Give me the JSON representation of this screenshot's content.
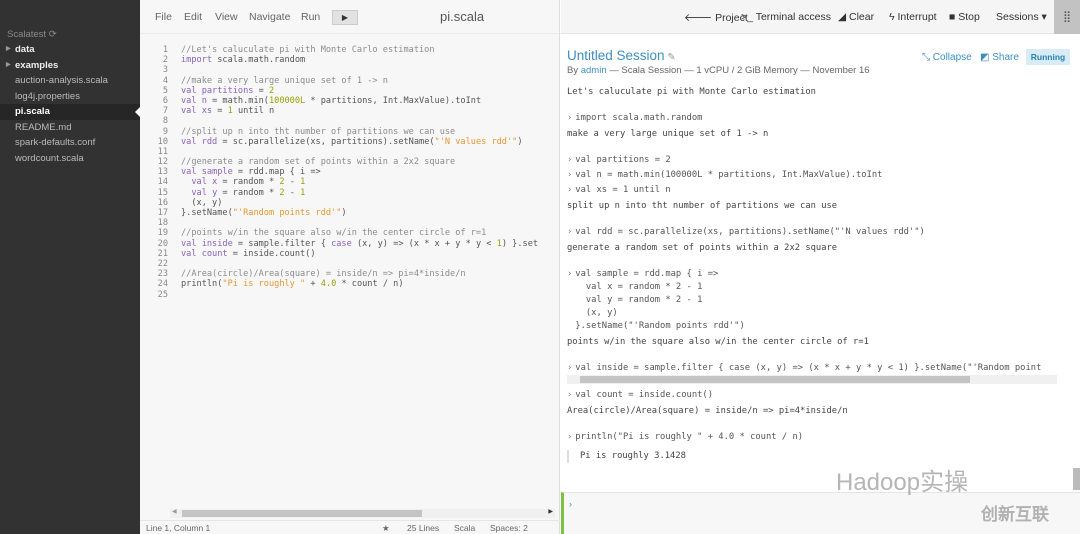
{
  "sidebar": {
    "project": "Scalatest",
    "refresh_icon": "refresh-icon",
    "items": [
      {
        "label": "data",
        "type": "folder"
      },
      {
        "label": "examples",
        "type": "folder"
      },
      {
        "label": "auction-analysis.scala",
        "type": "file"
      },
      {
        "label": "log4j.properties",
        "type": "file"
      },
      {
        "label": "pi.scala",
        "type": "file",
        "selected": true
      },
      {
        "label": "README.md",
        "type": "file"
      },
      {
        "label": "spark-defaults.conf",
        "type": "file"
      },
      {
        "label": "wordcount.scala",
        "type": "file"
      }
    ]
  },
  "editor": {
    "menu": [
      "File",
      "Edit",
      "View",
      "Navigate",
      "Run"
    ],
    "run_icon": "play-icon",
    "file_title": "pi.scala",
    "lines": [
      [
        [
          "c",
          "//Let's caluculate pi with Monte Carlo estimation"
        ]
      ],
      [
        [
          "k",
          "import"
        ],
        [
          "p",
          " scala.math.random"
        ]
      ],
      [],
      [
        [
          "c",
          "//make a very large unique set of 1 -> n"
        ]
      ],
      [
        [
          "k",
          "val"
        ],
        [
          "v",
          " partitions"
        ],
        [
          "p",
          " = "
        ],
        [
          "n",
          "2"
        ]
      ],
      [
        [
          "k",
          "val"
        ],
        [
          "v",
          " n"
        ],
        [
          "p",
          " = math.min("
        ],
        [
          "n",
          "100000L"
        ],
        [
          "p",
          " * partitions, Int.MaxValue).toInt"
        ]
      ],
      [
        [
          "k",
          "val"
        ],
        [
          "v",
          " xs"
        ],
        [
          "p",
          " = "
        ],
        [
          "n",
          "1"
        ],
        [
          "p",
          " until n"
        ]
      ],
      [],
      [
        [
          "c",
          "//split up n into tht number of partitions we can use"
        ]
      ],
      [
        [
          "k",
          "val"
        ],
        [
          "v",
          " rdd"
        ],
        [
          "p",
          " = sc.parallelize(xs, partitions).setName("
        ],
        [
          "s",
          "\"'N values rdd'\""
        ],
        [
          "p",
          ")"
        ]
      ],
      [],
      [
        [
          "c",
          "//generate a random set of points within a 2x2 square"
        ]
      ],
      [
        [
          "k",
          "val"
        ],
        [
          "v",
          " sample"
        ],
        [
          "p",
          " = rdd.map { i =>"
        ]
      ],
      [
        [
          "p",
          "  "
        ],
        [
          "k",
          "val"
        ],
        [
          "v",
          " x"
        ],
        [
          "p",
          " = random * "
        ],
        [
          "n",
          "2"
        ],
        [
          "p",
          " - "
        ],
        [
          "n",
          "1"
        ]
      ],
      [
        [
          "p",
          "  "
        ],
        [
          "k",
          "val"
        ],
        [
          "v",
          " y"
        ],
        [
          "p",
          " = random * "
        ],
        [
          "n",
          "2"
        ],
        [
          "p",
          " - "
        ],
        [
          "n",
          "1"
        ]
      ],
      [
        [
          "p",
          "  (x, y)"
        ]
      ],
      [
        [
          "p",
          "}.setName("
        ],
        [
          "s",
          "\"'Random points rdd'\""
        ],
        [
          "p",
          ")"
        ]
      ],
      [],
      [
        [
          "c",
          "//points w/in the square also w/in the center circle of r=1"
        ]
      ],
      [
        [
          "k",
          "val"
        ],
        [
          "v",
          " inside"
        ],
        [
          "p",
          " = sample.filter { "
        ],
        [
          "k",
          "case"
        ],
        [
          "p",
          " (x, y) => (x * x + y * y < "
        ],
        [
          "n",
          "1"
        ],
        [
          "p",
          ") }.set"
        ]
      ],
      [
        [
          "k",
          "val"
        ],
        [
          "v",
          " count"
        ],
        [
          "p",
          " = inside.count()"
        ]
      ],
      [],
      [
        [
          "c",
          "//Area(circle)/Area(square) = inside/n => pi=4*inside/n"
        ]
      ],
      [
        [
          "p",
          "println("
        ],
        [
          "s",
          "\"Pi is roughly \""
        ],
        [
          "p",
          " + "
        ],
        [
          "n",
          "4.0"
        ],
        [
          "p",
          " * count / n)"
        ]
      ],
      []
    ],
    "status": {
      "position": "Line 1, Column 1",
      "star_icon": "star-icon",
      "lines": "25 Lines",
      "language": "Scala",
      "indent": "Spaces: 2"
    }
  },
  "session": {
    "toolbar": {
      "project": "Project",
      "terminal": "Terminal access",
      "clear": "Clear",
      "interrupt": "Interrupt",
      "stop": "Stop",
      "sessions": "Sessions"
    },
    "title": "Untitled Session",
    "by": "By",
    "user": "admin",
    "meta": " — Scala Session — 1 vCPU / 2 GiB Memory — November 16",
    "collapse": "Collapse",
    "share": "Share",
    "status": "Running",
    "console": [
      {
        "kind": "text",
        "lines": [
          "Let's caluculate pi with Monte Carlo estimation"
        ]
      },
      {
        "kind": "code",
        "lines": [
          "import scala.math.random"
        ]
      },
      {
        "kind": "text",
        "lines": [
          "make a very large unique set of 1 -> n"
        ]
      },
      {
        "kind": "code",
        "lines": [
          "val partitions = 2"
        ]
      },
      {
        "kind": "code",
        "lines": [
          "val n = math.min(100000L * partitions, Int.MaxValue).toInt"
        ]
      },
      {
        "kind": "code",
        "lines": [
          "val xs = 1 until n"
        ]
      },
      {
        "kind": "text",
        "lines": [
          "split up n into tht number of partitions we can use"
        ]
      },
      {
        "kind": "code",
        "lines": [
          "val rdd = sc.parallelize(xs, partitions).setName(\"'N values rdd'\")"
        ]
      },
      {
        "kind": "text",
        "lines": [
          "generate a random set of points within a 2x2 square"
        ]
      },
      {
        "kind": "code",
        "lines": [
          "val sample = rdd.map { i =>",
          "  val x = random * 2 - 1",
          "  val y = random * 2 - 1",
          "  (x, y)",
          "}.setName(\"'Random points rdd'\")"
        ]
      },
      {
        "kind": "text",
        "lines": [
          "points w/in the square also w/in the center circle of r=1"
        ]
      },
      {
        "kind": "code",
        "lines": [
          "val inside = sample.filter { case (x, y) => (x * x + y * y < 1) }.setName(\"'Random point"
        ]
      },
      {
        "kind": "code",
        "lines": [
          "val count = inside.count()"
        ]
      },
      {
        "kind": "text",
        "lines": [
          "Area(circle)/Area(square) = inside/n => pi=4*inside/n"
        ]
      },
      {
        "kind": "code",
        "lines": [
          "println(\"Pi is roughly \" + 4.0 * count / n)"
        ]
      }
    ],
    "output": "Pi is roughly 3.1428"
  },
  "watermarks": [
    "Hadoop实操",
    "创新互联"
  ],
  "colors": {
    "accent": "#3d8fc0",
    "running_bg": "#d8ecf6",
    "input_border": "#7dc142",
    "sidebar_bg": "#323232"
  }
}
